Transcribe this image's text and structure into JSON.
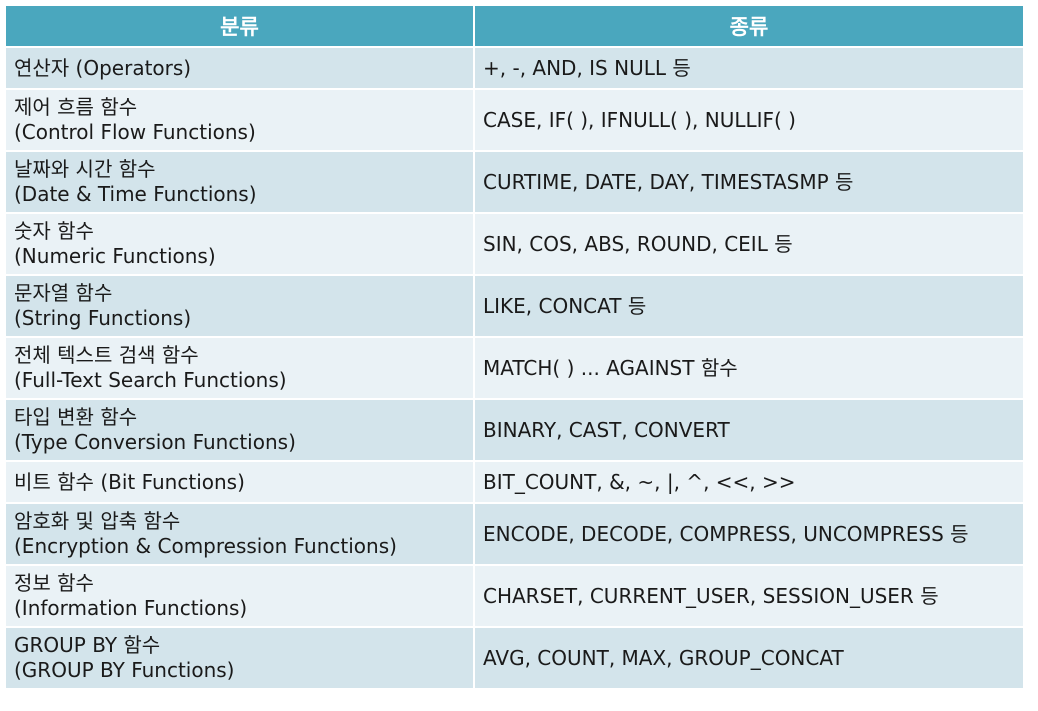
{
  "header": {
    "category": "분류",
    "kinds": "종류"
  },
  "rows": [
    {
      "category_line1": "연산자 (Operators)",
      "category_line2": "",
      "kinds": "+, -, AND, IS NULL 등"
    },
    {
      "category_line1": "제어 흐름 함수",
      "category_line2": "(Control Flow Functions)",
      "kinds": "CASE, IF( ), IFNULL( ), NULLIF( )"
    },
    {
      "category_line1": "날짜와 시간 함수",
      "category_line2": "(Date & Time Functions)",
      "kinds": "CURTIME, DATE, DAY, TIMESTASMP 등"
    },
    {
      "category_line1": "숫자 함수",
      "category_line2": "(Numeric Functions)",
      "kinds": "SIN, COS, ABS, ROUND, CEIL 등"
    },
    {
      "category_line1": "문자열 함수",
      "category_line2": "(String Functions)",
      "kinds": "LIKE, CONCAT 등"
    },
    {
      "category_line1": "전체 텍스트 검색 함수",
      "category_line2": "(Full-Text Search Functions)",
      "kinds": "MATCH( ) ... AGAINST 함수"
    },
    {
      "category_line1": "타입 변환 함수",
      "category_line2": "(Type Conversion Functions)",
      "kinds": "BINARY, CAST, CONVERT"
    },
    {
      "category_line1": "비트 함수 (Bit Functions)",
      "category_line2": "",
      "kinds": "BIT_COUNT, &, ~, |, ^, <<, >>"
    },
    {
      "category_line1": "암호화 및 압축 함수",
      "category_line2": "(Encryption & Compression Functions)",
      "kinds": "ENCODE, DECODE, COMPRESS, UNCOMPRESS 등"
    },
    {
      "category_line1": "정보 함수",
      "category_line2": "(Information Functions)",
      "kinds": "CHARSET, CURRENT_USER, SESSION_USER 등"
    },
    {
      "category_line1": "GROUP BY 함수",
      "category_line2": "(GROUP BY Functions)",
      "kinds": "AVG, COUNT, MAX, GROUP_CONCAT"
    }
  ],
  "colors": {
    "header_bg": "#4aa7be",
    "row_odd_bg": "#d3e4eb",
    "row_even_bg": "#eaf2f6"
  }
}
